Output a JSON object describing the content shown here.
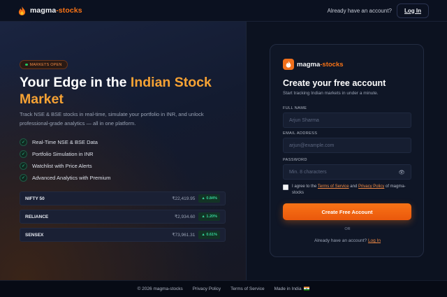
{
  "header": {
    "brand_main": "magma",
    "brand_accent": "-stocks",
    "account_prompt": "Already have an account?",
    "login_label": "Log In"
  },
  "hero": {
    "badge": "MARKETS OPEN",
    "title_main": "Your Edge in the ",
    "title_highlight": "Indian Stock Market",
    "description": "Track NSE & BSE stocks in real-time, simulate your portfolio in INR, and unlock professional-grade analytics — all in one platform.",
    "features": [
      {
        "label": "Real-Time NSE & BSE Data",
        "icon": "check-icon"
      },
      {
        "label": "Portfolio Simulation in INR",
        "icon": "check-icon"
      },
      {
        "label": "Watchlist with Price Alerts",
        "icon": "check-icon"
      },
      {
        "label": "Advanced Analytics with Premium",
        "icon": "check-icon"
      }
    ],
    "tickers": [
      {
        "name": "NIFTY 50",
        "price": "₹22,419.95",
        "change": "▲ 0.84%"
      },
      {
        "name": "RELIANCE",
        "price": "₹2,934.60",
        "change": "▲ 1.20%"
      },
      {
        "name": "SENSEX",
        "price": "₹73,961.31",
        "change": "▲ 0.61%"
      }
    ]
  },
  "signup": {
    "brand_main": "magma",
    "brand_accent": "-stocks",
    "title": "Create your free account",
    "subtitle": "Start tracking Indian markets in under a minute.",
    "fullname_label": "FULL NAME",
    "fullname_placeholder": "Arjun Sharma",
    "email_label": "EMAIL ADDRESS",
    "email_placeholder": "arjun@example.com",
    "password_label": "PASSWORD",
    "password_placeholder": "Min. 8 characters",
    "terms_prefix": "I agree to the ",
    "terms_link": "Terms of Service",
    "terms_and": " and ",
    "privacy_link": "Privacy Policy",
    "terms_suffix": " of magma-stocks",
    "cta_label": "Create Free Account",
    "or_label": "OR",
    "footer_prompt": "Already have an account? ",
    "footer_login": "Log In"
  },
  "footer": {
    "copyright": "© 2026 magma-stocks",
    "privacy": "Privacy Policy",
    "terms": "Terms of Service",
    "made_in": "Made in India"
  },
  "colors": {
    "accent": "#f97316",
    "highlight": "#f6a234",
    "positive": "#34d399",
    "background": "#0a0f1c"
  }
}
